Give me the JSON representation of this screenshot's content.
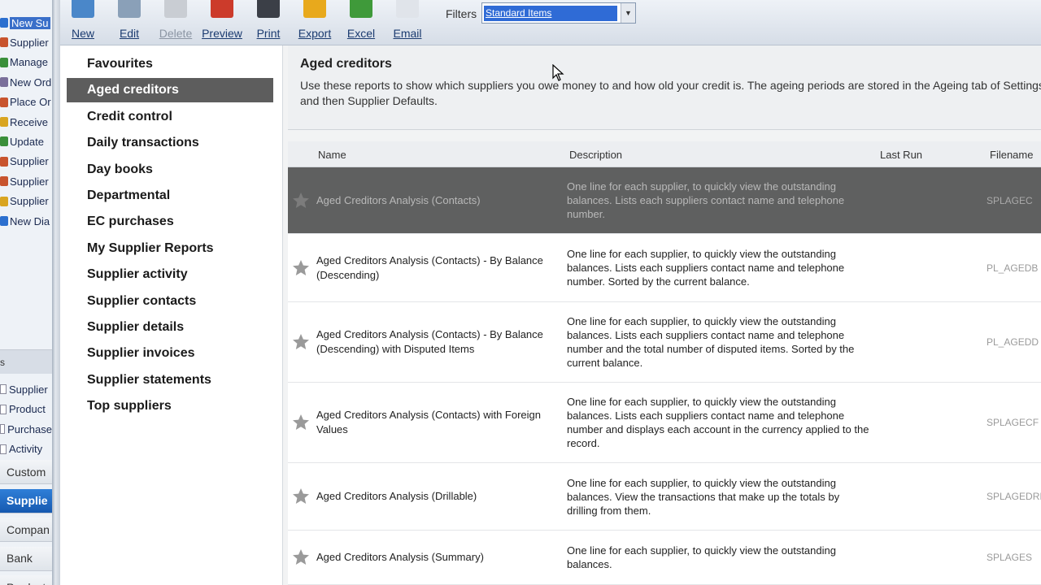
{
  "left_pane": {
    "tasks": [
      {
        "label": "New Su",
        "selected": true,
        "color": "#2b6fcf"
      },
      {
        "label": "Supplier",
        "selected": false,
        "color": "#c8542e"
      },
      {
        "label": "Manage",
        "selected": false,
        "color": "#3a8f3a"
      },
      {
        "label": "New Ord",
        "selected": false,
        "color": "#7a6f9a"
      },
      {
        "label": "Place Or",
        "selected": false,
        "color": "#c8542e"
      },
      {
        "label": "Receive",
        "selected": false,
        "color": "#d9a521"
      },
      {
        "label": "Update",
        "selected": false,
        "color": "#3a8f3a"
      },
      {
        "label": "Supplier",
        "selected": false,
        "color": "#c8542e"
      },
      {
        "label": "Supplier",
        "selected": false,
        "color": "#c8542e"
      },
      {
        "label": "Supplier",
        "selected": false,
        "color": "#d9a521"
      },
      {
        "label": "New Dia",
        "selected": false,
        "color": "#2b6fcf"
      }
    ],
    "separator_label": "s",
    "links": [
      {
        "label": "Supplier"
      },
      {
        "label": "Product"
      },
      {
        "label": "Purchase"
      },
      {
        "label": "Activity"
      }
    ],
    "nav": [
      {
        "label": "Custom",
        "active": false
      },
      {
        "label": "Supplie",
        "active": true
      },
      {
        "label": "Compan",
        "active": false
      },
      {
        "label": "Bank",
        "active": false
      },
      {
        "label": "Product",
        "active": false
      }
    ]
  },
  "toolbar": {
    "buttons": [
      {
        "label": "New",
        "icon": "new-icon",
        "enabled": true,
        "color": "#4a87c9"
      },
      {
        "label": "Edit",
        "icon": "edit-icon",
        "enabled": true,
        "color": "#8aa0b8"
      },
      {
        "label": "Delete",
        "icon": "delete-icon",
        "enabled": false,
        "color": "#c9cdd3"
      },
      {
        "label": "Preview",
        "icon": "preview-icon",
        "enabled": true,
        "color": "#cc3b2b"
      },
      {
        "label": "Print",
        "icon": "print-icon",
        "enabled": true,
        "color": "#3b3f47"
      },
      {
        "label": "Export",
        "icon": "export-icon",
        "enabled": true,
        "color": "#e8a91c"
      },
      {
        "label": "Excel",
        "icon": "excel-icon",
        "enabled": true,
        "color": "#3f9a3a"
      },
      {
        "label": "Email",
        "icon": "email-icon",
        "enabled": true,
        "color": "#e0e4ea"
      }
    ],
    "filters_label": "Filters",
    "filter_value": "Standard Items"
  },
  "categories": {
    "items": [
      {
        "label": "Favourites",
        "selected": false
      },
      {
        "label": "Aged creditors",
        "selected": true
      },
      {
        "label": "Credit control",
        "selected": false
      },
      {
        "label": "Daily transactions",
        "selected": false
      },
      {
        "label": "Day books",
        "selected": false
      },
      {
        "label": "Departmental",
        "selected": false
      },
      {
        "label": "EC purchases",
        "selected": false
      },
      {
        "label": "My Supplier Reports",
        "selected": false
      },
      {
        "label": "Supplier activity",
        "selected": false
      },
      {
        "label": "Supplier contacts",
        "selected": false
      },
      {
        "label": "Supplier details",
        "selected": false
      },
      {
        "label": "Supplier invoices",
        "selected": false
      },
      {
        "label": "Supplier statements",
        "selected": false
      },
      {
        "label": "Top suppliers",
        "selected": false
      }
    ]
  },
  "section": {
    "title": "Aged creditors",
    "description": "Use these reports to show which suppliers you owe money to and how old your credit is. The ageing periods are stored in the Ageing tab of Settings and then Supplier Defaults."
  },
  "table": {
    "columns": {
      "name": "Name",
      "description": "Description",
      "last_run": "Last Run",
      "filename": "Filename"
    },
    "rows": [
      {
        "name": "Aged Creditors Analysis (Contacts)",
        "description": "One line for each supplier, to quickly view the outstanding balances. Lists each suppliers contact name and telephone number.",
        "last_run": "",
        "filename": "SPLAGEC",
        "selected": true
      },
      {
        "name": "Aged Creditors Analysis (Contacts) - By Balance (Descending)",
        "description": "One line for each supplier, to quickly view the outstanding balances. Lists each suppliers contact name and telephone number. Sorted by the current balance.",
        "last_run": "",
        "filename": "PL_AGEDB",
        "selected": false
      },
      {
        "name": "Aged Creditors Analysis (Contacts) - By Balance (Descending) with Disputed Items",
        "description": "One line for each supplier, to quickly view the outstanding balances. Lists each suppliers contact name and telephone number and the total number of disputed items. Sorted by the current balance.",
        "last_run": "",
        "filename": "PL_AGEDD",
        "selected": false
      },
      {
        "name": "Aged Creditors Analysis (Contacts) with Foreign Values",
        "description": "One line for each supplier, to quickly view the outstanding balances. Lists each suppliers contact name and telephone number and displays each account in the currency applied to the record.",
        "last_run": "",
        "filename": "SPLAGECF",
        "selected": false
      },
      {
        "name": "Aged Creditors Analysis (Drillable)",
        "description": "One line for each supplier, to quickly view the outstanding balances. View the transactions that make up the totals by drilling from them.",
        "last_run": "",
        "filename": "SPLAGEDRI",
        "selected": false
      },
      {
        "name": "Aged Creditors Analysis (Summary)",
        "description": "One line for each supplier, to quickly view the outstanding balances.",
        "last_run": "",
        "filename": "SPLAGES",
        "selected": false
      }
    ]
  }
}
